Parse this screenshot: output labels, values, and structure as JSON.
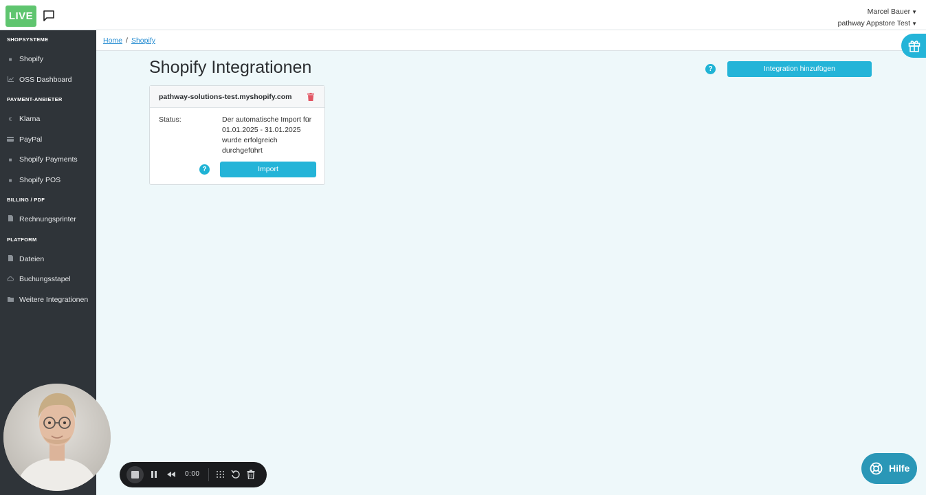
{
  "header": {
    "live_badge": "LIVE",
    "user_name": "Marcel Bauer",
    "account_name": "pathway Appstore Test"
  },
  "sidebar": {
    "sections": [
      {
        "title": "SHOPSYSTEME",
        "items": [
          {
            "label": "Shopify",
            "icon": "shopping-bag-icon"
          },
          {
            "label": "OSS Dashboard",
            "icon": "line-chart-icon"
          }
        ]
      },
      {
        "title": "PAYMENT-ANBIETER",
        "items": [
          {
            "label": "Klarna",
            "icon": "euro-icon"
          },
          {
            "label": "PayPal",
            "icon": "credit-card-icon"
          },
          {
            "label": "Shopify Payments",
            "icon": "shopping-bag-icon"
          },
          {
            "label": "Shopify POS",
            "icon": "shopping-bag-icon"
          }
        ]
      },
      {
        "title": "BILLING / PDF",
        "items": [
          {
            "label": "Rechnungsprinter",
            "icon": "document-icon"
          }
        ]
      },
      {
        "title": "PLATFORM",
        "items": [
          {
            "label": "Dateien",
            "icon": "file-icon"
          },
          {
            "label": "Buchungsstapel",
            "icon": "upload-cloud-icon"
          },
          {
            "label": "Weitere Integrationen",
            "icon": "folder-icon"
          }
        ]
      }
    ]
  },
  "breadcrumb": {
    "home": "Home",
    "separator": "/",
    "current": "Shopify"
  },
  "main": {
    "title": "Shopify Integrationen",
    "help_glyph": "?",
    "add_button": "Integration hinzufügen"
  },
  "card": {
    "shop_domain": "pathway-solutions-test.myshopify.com",
    "status_label": "Status:",
    "status_value": "Der automatische Import für 01.01.2025 - 31.01.2025 wurde erfolgreich durchgeführt",
    "help_glyph": "?",
    "import_button": "Import"
  },
  "help_widget": {
    "label": "Hilfe"
  },
  "recorder": {
    "time": "0:00"
  },
  "colors": {
    "accent": "#24b4d8",
    "live": "#5fc56f",
    "sidebar": "#2f3439",
    "danger": "#e25563",
    "help_widget": "#2a97b7"
  }
}
